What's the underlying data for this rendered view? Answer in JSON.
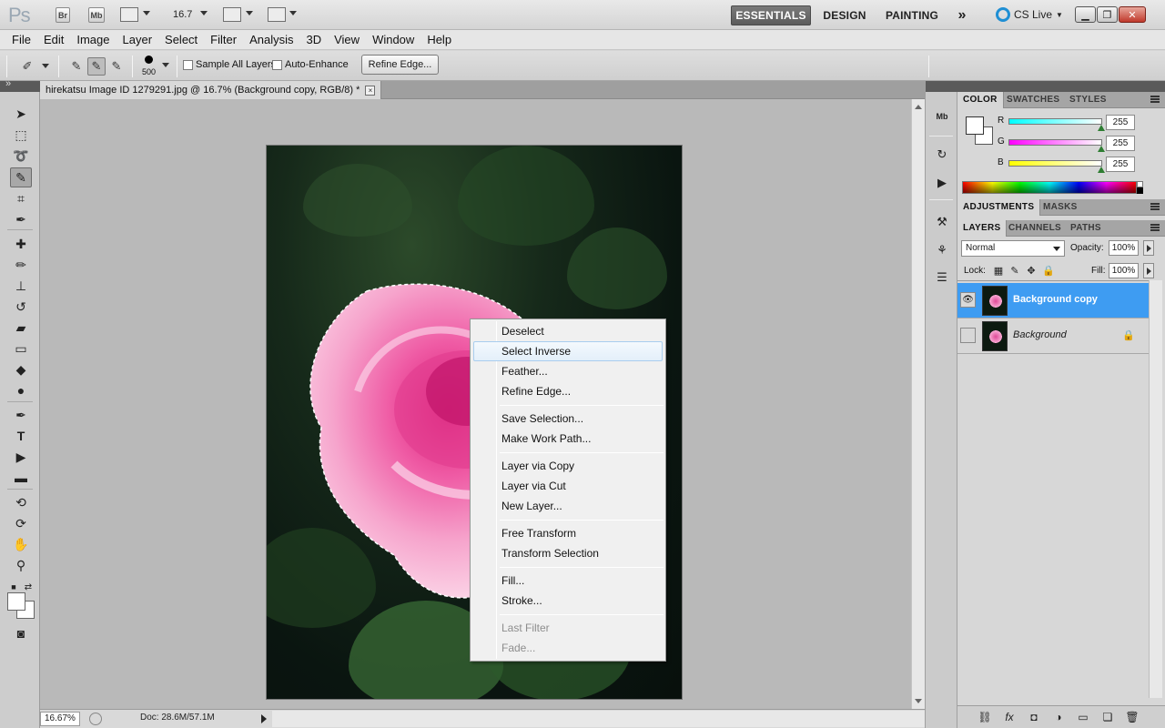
{
  "appbar": {
    "logo": "Ps",
    "bridge_label": "Br",
    "minibridge_label": "Mb",
    "zoom": "16.7",
    "workspaces": [
      "ESSENTIALS",
      "DESIGN",
      "PAINTING"
    ],
    "more": "»",
    "cslive": "CS Live"
  },
  "menubar": [
    "File",
    "Edit",
    "Image",
    "Layer",
    "Select",
    "Filter",
    "Analysis",
    "3D",
    "View",
    "Window",
    "Help"
  ],
  "options": {
    "brush_size": "500",
    "sample_all_layers": "Sample All Layers",
    "auto_enhance": "Auto-Enhance",
    "refine_edge": "Refine Edge..."
  },
  "document": {
    "tab_title": "hirekatsu Image ID 1279291.jpg @ 16.7% (Background copy, RGB/8) *",
    "close": "×",
    "zoom_status": "16.67%",
    "doc_info": "Doc: 28.6M/57.1M"
  },
  "context_menu": {
    "groups": [
      [
        "Deselect",
        "Select Inverse",
        "Feather...",
        "Refine Edge..."
      ],
      [
        "Save Selection...",
        "Make Work Path..."
      ],
      [
        "Layer via Copy",
        "Layer via Cut",
        "New Layer..."
      ],
      [
        "Free Transform",
        "Transform Selection"
      ],
      [
        "Fill...",
        "Stroke..."
      ],
      [
        "Last Filter",
        "Fade..."
      ]
    ],
    "hovered": "Select Inverse",
    "disabled": [
      "Last Filter",
      "Fade..."
    ]
  },
  "color_panel": {
    "tabs": [
      "COLOR",
      "SWATCHES",
      "STYLES"
    ],
    "channels": [
      {
        "label": "R",
        "value": "255",
        "gradient": "#00ffff"
      },
      {
        "label": "G",
        "value": "255",
        "gradient": "#ff00ff"
      },
      {
        "label": "B",
        "value": "255",
        "gradient": "#ffff00"
      }
    ]
  },
  "adjustments_panel": {
    "tabs": [
      "ADJUSTMENTS",
      "MASKS"
    ]
  },
  "layers_panel": {
    "tabs": [
      "LAYERS",
      "CHANNELS",
      "PATHS"
    ],
    "blend_mode": "Normal",
    "opacity_label": "Opacity:",
    "opacity": "100%",
    "lock_label": "Lock:",
    "fill_label": "Fill:",
    "fill": "100%",
    "layers": [
      {
        "name": "Background copy",
        "selected": true,
        "visible": true,
        "locked": false
      },
      {
        "name": "Background",
        "selected": false,
        "visible": false,
        "locked": true
      }
    ]
  },
  "colors": {
    "selection": "#3e9cf2",
    "workspace_active": "#5c5c5c"
  }
}
